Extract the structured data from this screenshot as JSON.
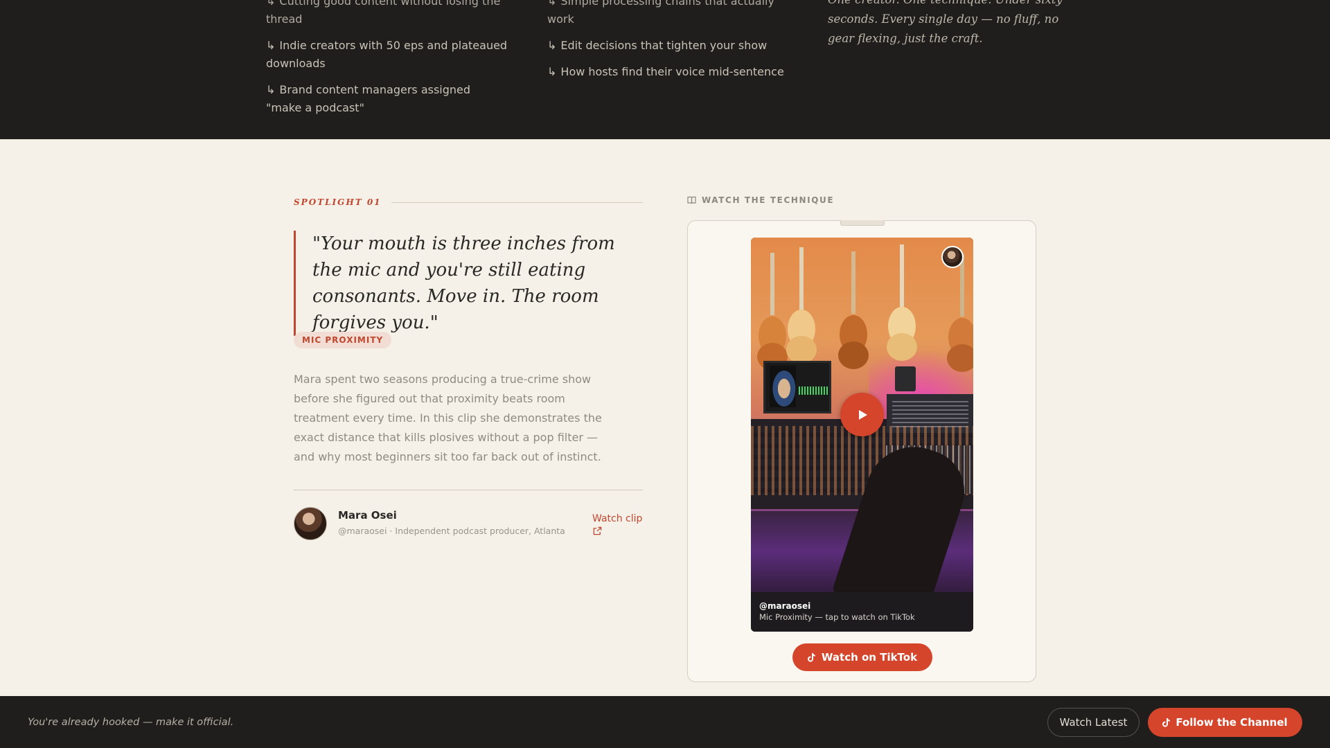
{
  "top": {
    "col1": [
      "Indie creators with 50 eps and plateaued downloads",
      "Brand content managers assigned \"make a podcast\""
    ],
    "col2": [
      "Edit decisions that tighten your show",
      "How hosts find their voice mid-sentence"
    ],
    "col3_text": "One creator. One technique. Under sixty seconds. Every single day — no fluff, no gear flexing, just the craft.",
    "arrow_glyph": "↳"
  },
  "spotlight": {
    "label": "SPOTLIGHT 01",
    "quote": "\"Your mouth is three inches from the mic and you're still eating consonants. Move in. The room forgives you.\"",
    "tag": "MIC PROXIMITY",
    "description": "Mara spent two seasons producing a true-crime show before she figured out that proximity beats room treatment every time. In this clip she demonstrates the exact distance that kills plosives without a pop filter — and why most beginners sit too far back out of instinct.",
    "author": {
      "name": "Mara Osei",
      "meta": "@maraosei · Independent podcast producer, Atlanta"
    },
    "watch_clip_label": "Watch clip"
  },
  "video_card": {
    "heading": "WATCH THE TECHNIQUE",
    "username": "@maraosei",
    "caption": "Mic Proximity — tap to watch on TikTok",
    "button_label": "Watch on TikTok"
  },
  "bottom_bar": {
    "text": "You're already hooked — make it official.",
    "watch_latest_label": "Watch Latest",
    "follow_label": "Follow the Channel"
  },
  "colors": {
    "accent": "#d4452c",
    "dark": "#1f1e1c",
    "cream": "#f5f0e8"
  }
}
